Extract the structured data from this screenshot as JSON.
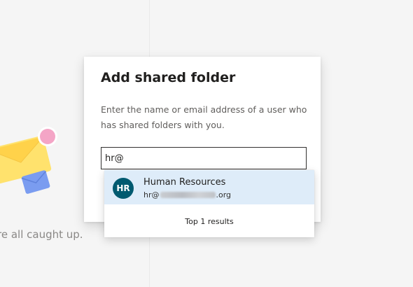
{
  "background": {
    "empty_state_text": "re all caught up."
  },
  "dialog": {
    "title": "Add shared folder",
    "description": "Enter the name or email address of a user who has shared folders with you.",
    "input_value": "hr@"
  },
  "suggestions": {
    "items": [
      {
        "initials": "HR",
        "name": "Human Resources",
        "email_prefix": "hr@",
        "email_suffix": ".org",
        "avatar_color": "#005a70"
      }
    ],
    "results_label": "Top 1 results"
  },
  "colors": {
    "highlight": "#deecf9",
    "input_border": "#323130",
    "envelope_yellow": "#ffe26d",
    "envelope_blue": "#7a9cf0",
    "badge_pink": "#f4a5c6"
  }
}
